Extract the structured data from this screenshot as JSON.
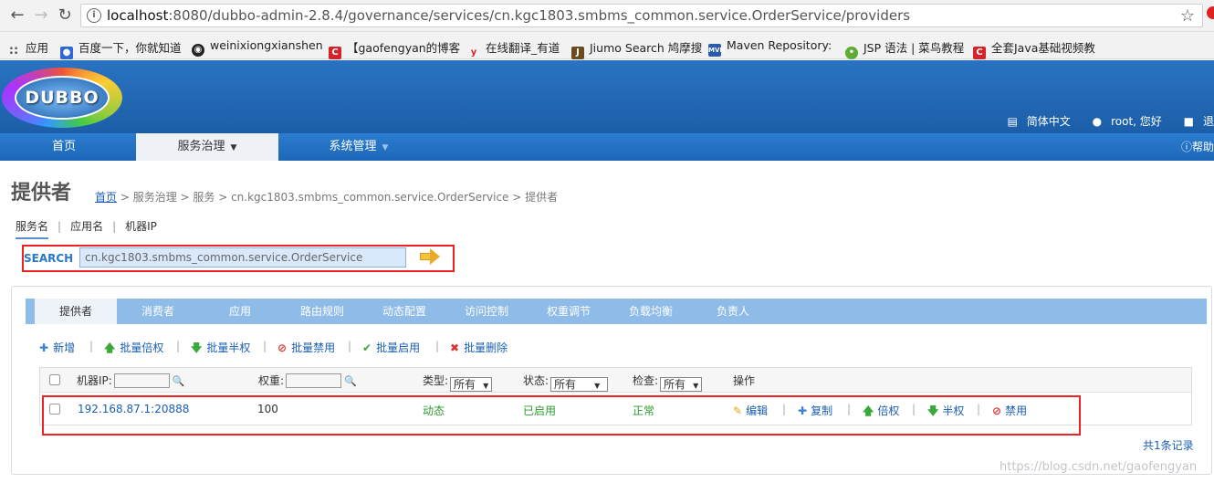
{
  "browser": {
    "url_host": "localhost",
    "url_rest": ":8080/dubbo-admin-2.8.4/governance/services/cn.kgc1803.smbms_common.service.OrderService/providers",
    "bookmarks": [
      "应用",
      "百度一下，你就知道",
      "weinixiongxianshen",
      "【gaofengyan的博客",
      "在线翻译_有道",
      "Jiumo Search 鸠摩搜",
      "Maven Repository: ",
      "JSP 语法 | 菜鸟教程",
      "全套Java基础视频教"
    ]
  },
  "header": {
    "logo_text": "DUBBO",
    "language": "简体中文",
    "user": "root, 您好",
    "logout": "退"
  },
  "nav": {
    "home": "首页",
    "governance": "服务治理",
    "system": "系统管理",
    "help": "帮助"
  },
  "page": {
    "title": "提供者",
    "breadcrumb_home": "首页",
    "breadcrumb_rest": " > 服务治理 > 服务 > cn.kgc1803.smbms_common.service.OrderService > 提供者",
    "subtabs": [
      "服务名",
      "应用名",
      "机器IP"
    ]
  },
  "search": {
    "label": "SEARCH",
    "value": "cn.kgc1803.smbms_common.service.OrderService"
  },
  "tabs": [
    "提供者",
    "消费者",
    "应用",
    "路由规则",
    "动态配置",
    "访问控制",
    "权重调节",
    "负载均衡",
    "负责人"
  ],
  "toolbar": [
    {
      "label": "新增",
      "icon": "plus-icon"
    },
    {
      "label": "批量倍权",
      "icon": "arrow-up-icon"
    },
    {
      "label": "批量半权",
      "icon": "arrow-down-icon"
    },
    {
      "label": "批量禁用",
      "icon": "ban-icon"
    },
    {
      "label": "批量启用",
      "icon": "check-icon"
    },
    {
      "label": "批量删除",
      "icon": "cross-icon"
    }
  ],
  "table": {
    "headers": {
      "ip": "机器IP:",
      "weight": "权重:",
      "type": "类型:",
      "status": "状态:",
      "check": "检查:",
      "ops": "操作"
    },
    "filters": {
      "type": "所有",
      "status": "所有",
      "check": "所有"
    },
    "rows": [
      {
        "ip": "192.168.87.1:20888",
        "weight": "100",
        "type": "动态",
        "status": "已启用",
        "check": "正常",
        "actions": [
          "编辑",
          "复制",
          "倍权",
          "半权",
          "禁用"
        ]
      }
    ],
    "count": "共1条记录"
  },
  "watermark": "https://blog.csdn.net/gaofengyan"
}
